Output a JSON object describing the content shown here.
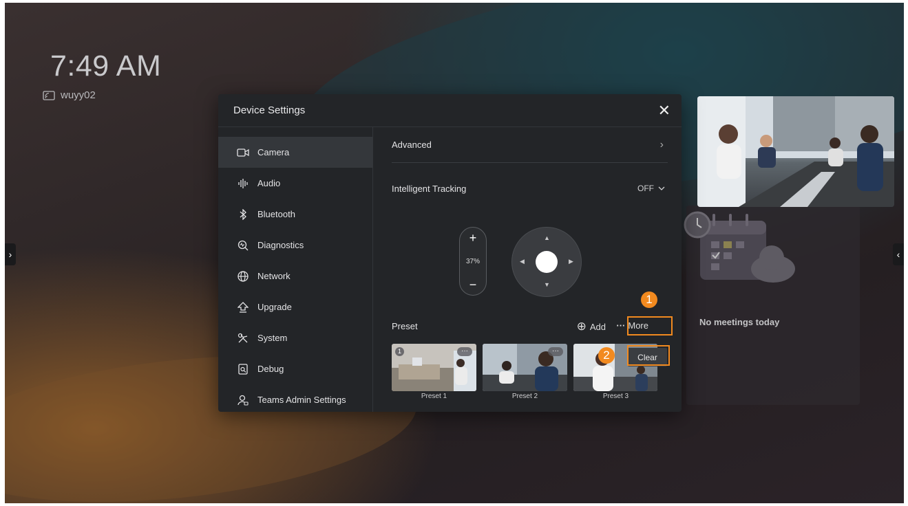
{
  "clock": {
    "time": "7:49 AM"
  },
  "room": {
    "name": "wuyy02",
    "icon": "cast-screen-icon"
  },
  "right_panel": {
    "status": "No meetings today"
  },
  "edge_tabs": {
    "left_icon": "chevron-right-icon",
    "right_icon": "chevron-left-icon",
    "left_glyph": "›",
    "right_glyph": "‹"
  },
  "dialog": {
    "title": "Device Settings",
    "close_glyph": "✕",
    "nav": [
      {
        "label": "Camera",
        "icon": "camera-icon",
        "active": true
      },
      {
        "label": "Audio",
        "icon": "audio-icon"
      },
      {
        "label": "Bluetooth",
        "icon": "bluetooth-icon"
      },
      {
        "label": "Diagnostics",
        "icon": "diagnostics-icon"
      },
      {
        "label": "Network",
        "icon": "globe-icon"
      },
      {
        "label": "Upgrade",
        "icon": "upgrade-icon"
      },
      {
        "label": "System",
        "icon": "tools-icon"
      },
      {
        "label": "Debug",
        "icon": "debug-icon"
      },
      {
        "label": "Teams Admin Settings",
        "icon": "admin-user-icon"
      }
    ],
    "camera": {
      "advanced_label": "Advanced",
      "advanced_chevron": "›",
      "tracking_label": "Intelligent Tracking",
      "tracking_value": "OFF",
      "zoom": {
        "plus": "+",
        "minus": "−",
        "percent": "37%"
      },
      "preset_label": "Preset",
      "add_label": "Add",
      "add_glyph": "⊕",
      "more_label": "More",
      "more_glyph": "···",
      "clear_label": "Clear",
      "presets": [
        {
          "label": "Preset 1",
          "number": "1"
        },
        {
          "label": "Preset 2"
        },
        {
          "label": "Preset 3"
        }
      ],
      "thumb_dots": "···"
    }
  },
  "annotations": {
    "step1": "1",
    "step2": "2",
    "color": "#f28a1f"
  }
}
